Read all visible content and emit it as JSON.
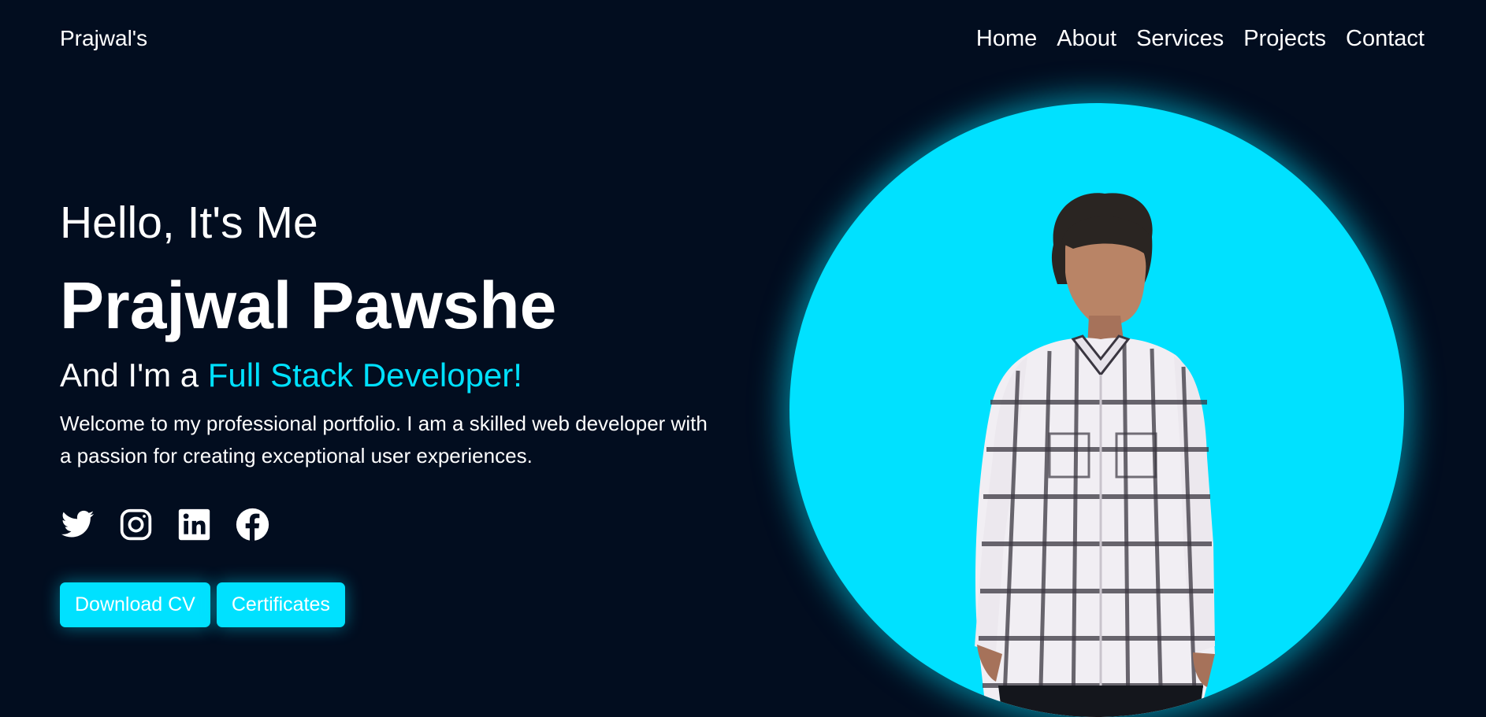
{
  "header": {
    "logo": "Prajwal's",
    "nav": [
      "Home",
      "About",
      "Services",
      "Projects",
      "Contact"
    ]
  },
  "hero": {
    "greeting": "Hello, It's Me",
    "name": "Prajwal Pawshe",
    "role_prefix": "And I'm a ",
    "role_highlight": "Full Stack Developer!",
    "description": "Welcome to my professional portfolio. I am a skilled web developer with a passion for creating exceptional user experiences.",
    "socials": [
      "twitter-icon",
      "instagram-icon",
      "linkedin-icon",
      "facebook-icon"
    ],
    "buttons": {
      "download_cv": "Download CV",
      "certificates": "Certificates"
    }
  },
  "colors": {
    "background": "#020d1f",
    "accent": "#00e1ff",
    "text": "#ffffff"
  }
}
